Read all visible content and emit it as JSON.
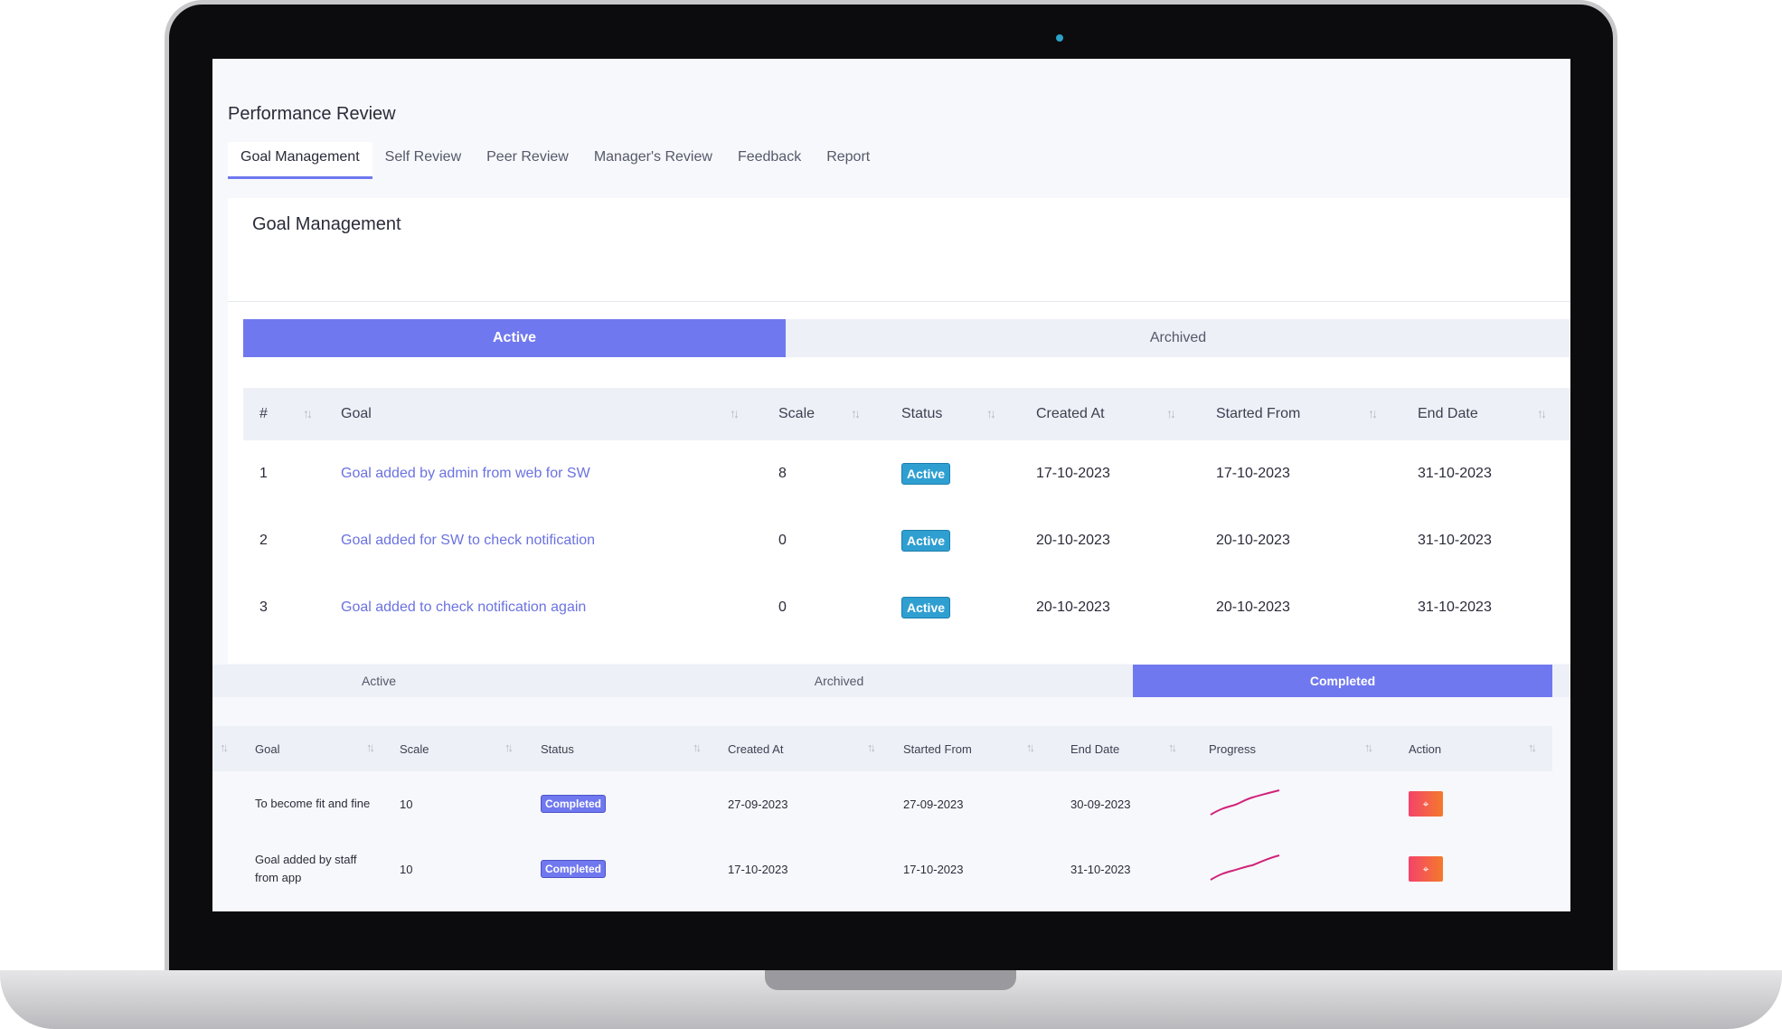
{
  "app": {
    "page_title": "Performance Review",
    "tabs": [
      "Goal Management",
      "Self Review",
      "Peer Review",
      "Manager's Review",
      "Feedback",
      "Report"
    ]
  },
  "goal_card": {
    "title": "Goal Management",
    "segments": [
      "Active",
      "Archived"
    ],
    "columns": [
      "#",
      "Goal",
      "Scale",
      "Status",
      "Created At",
      "Started From",
      "End Date"
    ],
    "rows": [
      {
        "num": "1",
        "goal": "Goal added by admin from web for SW",
        "scale": "8",
        "status": "Active",
        "created": "17-10-2023",
        "started": "17-10-2023",
        "end": "31-10-2023"
      },
      {
        "num": "2",
        "goal": "Goal added for SW to check notification",
        "scale": "0",
        "status": "Active",
        "created": "20-10-2023",
        "started": "20-10-2023",
        "end": "31-10-2023"
      },
      {
        "num": "3",
        "goal": "Goal added to check notification again",
        "scale": "0",
        "status": "Active",
        "created": "20-10-2023",
        "started": "20-10-2023",
        "end": "31-10-2023"
      }
    ]
  },
  "app_view": {
    "segments": [
      "Active",
      "Archived",
      "Completed"
    ],
    "columns": [
      "Goal",
      "Scale",
      "Status",
      "Created At",
      "Started From",
      "End Date",
      "Progress",
      "Action"
    ],
    "rows": [
      {
        "goal": "To become fit and fine",
        "scale": "10",
        "status": "Completed",
        "created": "27-09-2023",
        "started": "27-09-2023",
        "end": "30-09-2023"
      },
      {
        "goal": "Goal added by staff from app",
        "scale": "10",
        "status": "Completed",
        "created": "17-10-2023",
        "started": "17-10-2023",
        "end": "31-10-2023"
      }
    ]
  },
  "colors": {
    "accent": "#7078ef",
    "active_badge": "#2f9fd1",
    "progress_line": "#d1237a"
  },
  "icons": {
    "sort": "sort-arrows-icon",
    "action": "target-icon"
  }
}
